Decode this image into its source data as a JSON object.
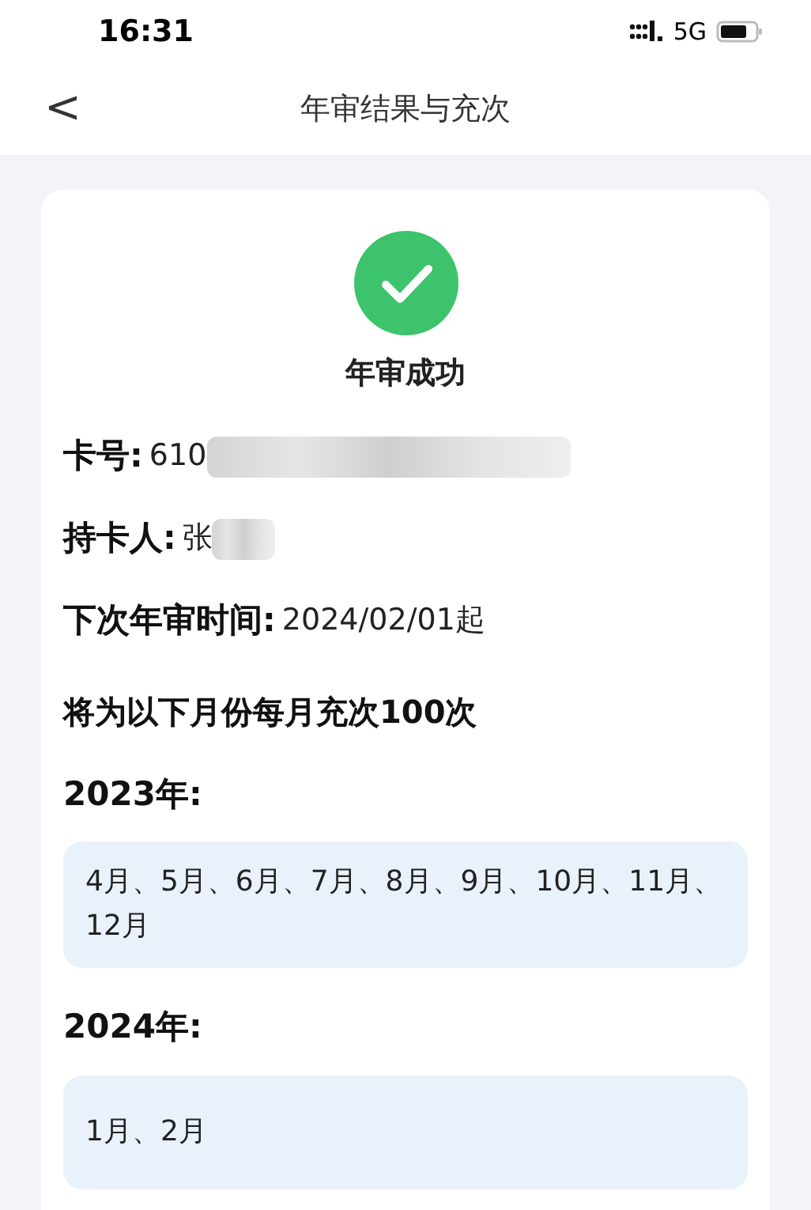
{
  "status_bar": {
    "time": "16:31",
    "network": "5G"
  },
  "nav": {
    "back": "<",
    "title": "年审结果与充次"
  },
  "result": {
    "title": "年审成功"
  },
  "fields": [
    {
      "label": "卡号:",
      "value": "610",
      "redacted": true
    },
    {
      "label": "持卡人:",
      "value": "张",
      "redacted": true
    },
    {
      "label": "下次年审时间:",
      "value": "2024/02/01起",
      "redacted": false
    }
  ],
  "summary": "将为以下月份每月充次100次",
  "years": [
    {
      "label": "2023年:",
      "months": "4月、5月、6月、7月、8月、9月、10月、11月、12月"
    },
    {
      "label": "2024年:",
      "months": "1月、2月"
    }
  ]
}
